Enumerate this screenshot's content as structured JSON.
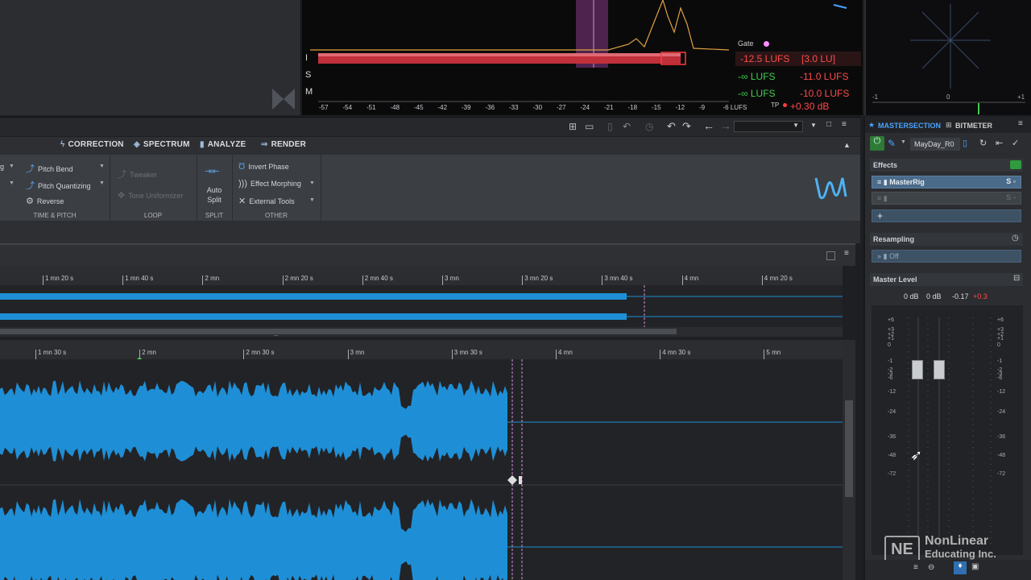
{
  "loudness": {
    "rows": [
      "I",
      "S",
      "M"
    ],
    "gate_label": "Gate",
    "integrated": "-12.5 LUFS",
    "range": "[3.0 LU]",
    "short_term_left": "-∞ LUFS",
    "short_term_right": "-11.0 LUFS",
    "momentary_left": "-∞ LUFS",
    "momentary_right": "-10.0 LUFS",
    "tp_label": "TP",
    "true_peak": "+0.30 dB",
    "scale": [
      "-57",
      "-54",
      "-51",
      "-48",
      "-45",
      "-42",
      "-39",
      "-36",
      "-33",
      "-30",
      "-27",
      "-24",
      "-21",
      "-18",
      "-15",
      "-12",
      "-9",
      "-6 LUFS"
    ]
  },
  "scope": {
    "left": "-1",
    "center": "0",
    "right": "+1"
  },
  "ribbon": {
    "tabs": [
      {
        "label": "CORRECTION",
        "icon": "lightning-icon"
      },
      {
        "label": "SPECTRUM",
        "icon": "spectrum-icon"
      },
      {
        "label": "ANALYZE",
        "icon": "bars-icon"
      },
      {
        "label": "RENDER",
        "icon": "render-icon"
      }
    ],
    "left_items": [
      "g",
      "",
      ""
    ],
    "pitch": {
      "pitch_bend": "Pitch Bend",
      "pitch_quantizing": "Pitch Quantizing",
      "reverse": "Reverse"
    },
    "loop": {
      "tweaker": "Tweaker",
      "tone_uniformizer": "Tone Uniformizer"
    },
    "split": {
      "auto_split_1": "Auto",
      "auto_split_2": "Split"
    },
    "other": {
      "invert_phase": "Invert Phase",
      "effect_morphing": "Effect Morphing",
      "external_tools": "External Tools"
    },
    "groups": {
      "time_pitch": "TIME & PITCH",
      "loop": "LOOP",
      "split": "SPLIT",
      "other": "OTHER"
    }
  },
  "overview_ruler": [
    "1 mn 20 s",
    "1 mn 40 s",
    "2 mn",
    "2 mn 20 s",
    "2 mn 40 s",
    "3 mn",
    "3 mn 20 s",
    "3 mn 40 s",
    "4 mn",
    "4 mn 20 s"
  ],
  "overview_handle": "...",
  "main_ruler": [
    "1 mn 30 s",
    "2 mn",
    "2 mn 30 s",
    "3 mn",
    "3 mn 30 s",
    "4 mn",
    "4 mn 30 s",
    "5 mn"
  ],
  "master": {
    "tab_master": "MASTERSECTION",
    "tab_bit": "BITMETER",
    "preset": "MayDay_R0",
    "effects_label": "Effects",
    "plugin": "MasterRig",
    "resampling_label": "Resampling",
    "resampling_value": "Off",
    "master_level_label": "Master Level",
    "levels": [
      "0 dB",
      "0 dB",
      "-0.17",
      "+0.3"
    ],
    "scale": [
      "+6",
      "+3",
      "+2",
      "+1",
      "0",
      "-1",
      "-2",
      "-3",
      "-6",
      "-12",
      "-24",
      "-36",
      "-48",
      "-72"
    ]
  },
  "watermark": {
    "line1": "NonLinear",
    "line2": "Educating Inc."
  },
  "colors": {
    "wave": "#1e8fd6",
    "accent": "#4aa3ff",
    "red": "#ff3b3b",
    "green": "#3fcf4a"
  }
}
